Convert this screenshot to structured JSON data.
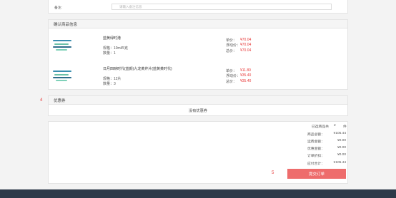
{
  "remark": {
    "label": "备注:",
    "placeholder": "请输入备注信息"
  },
  "goods": {
    "title": "确认商品信息",
    "items": [
      {
        "name": "蓝黄绿时港",
        "spec": "规格：10ml/5克",
        "qty": "数量：1",
        "price_label": "单价：",
        "price": "¥70.04",
        "float_label": "浮动价：",
        "float": "¥70.04",
        "total_label": "总价：",
        "total": "¥70.04"
      },
      {
        "name": "日月四映时代(蓝颜)九龙黄芹片(蓝黄黄时代)",
        "spec": "规格：12片",
        "qty": "数量：3",
        "price_label": "单价：",
        "price": "¥11.80",
        "float_label": "浮动价：",
        "float": "¥35.40",
        "total_label": "总价：",
        "total": "¥35.40"
      }
    ]
  },
  "coupon": {
    "marker": "4",
    "title": "优惠券",
    "empty_text": "没有优惠券"
  },
  "summary": {
    "rows": [
      {
        "label": "已选商品共",
        "value": "2",
        "unit": "件"
      },
      {
        "label": "商品总额：",
        "value": "¥105.44"
      },
      {
        "label": "运费金额：",
        "value": "¥0.00"
      },
      {
        "label": "优惠金额：",
        "value": "¥0.00"
      },
      {
        "label": "订单折扣：",
        "value": "¥0.00"
      },
      {
        "label": "应付合计：",
        "value": "¥105.44"
      }
    ],
    "marker": "5",
    "submit_label": "提交订单"
  },
  "colors": {
    "accent": "#ee6c6c",
    "price_red": "#e83a3a",
    "footer": "#2d3a49"
  }
}
